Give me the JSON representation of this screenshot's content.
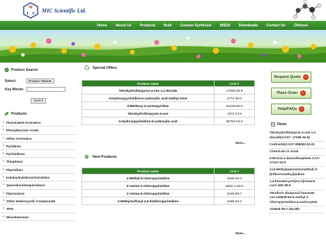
{
  "header": {
    "company": "MIC Scientific Ltd.",
    "logo_letters": [
      "M",
      "I",
      "C"
    ]
  },
  "nav": [
    "Home",
    "About Us",
    "Products",
    "Bulk",
    "Custom Synthesis",
    "MSDS",
    "Downloads",
    "Contact Us",
    "Chinese"
  ],
  "search": {
    "title": "Product Search",
    "select_label": "Select:",
    "select_value": "Product Name",
    "keyword_label": "Key Words:",
    "keyword_value": "",
    "button": "Search"
  },
  "products": {
    "title": "Products",
    "items": [
      "Fluorinated Aromatics",
      "Phenylboronic Acids",
      "Other Aromatics",
      "Pyridines",
      "Pyrimidines",
      "Thiophens",
      "Piperdines",
      "Indoles/Indolines/Oxindoles",
      "Quinolines/Isoquinolines",
      "Piperazines",
      "Other Heterocyclic Compounds",
      "APIs",
      "Miscellaneous"
    ]
  },
  "special_offers": {
    "title": "Special Offers",
    "headers": [
      "Product name",
      "CAS #"
    ],
    "rows": [
      [
        "Tetrahydrothiopyran-4-one 1,1-dioxide",
        "17396-35-9"
      ],
      [
        "4-Hydroxypyrimidine-5-carboxylic acid methyl ester",
        "4774-35-0"
      ],
      [
        "5-Methoxy-3-aminopyridine",
        "64436-92-6"
      ],
      [
        "Tetrahydrothiopyran-4-one",
        "1072-72-6"
      ],
      [
        "4-Hydroxypyrimidine-5-carboxylic acid",
        "65754-04-3"
      ]
    ],
    "more": "More..."
  },
  "new_products": {
    "title": "New Products",
    "headers": [
      "Product name",
      "CAS #"
    ],
    "rows": [
      [
        "4-Methyl-6-chloropyrimidine",
        "3435-25-4"
      ],
      [
        "5-Amino-2-chloropyrimidine",
        "5662-1-00-0"
      ],
      [
        "2-Amino-5-chloropyrimidine",
        "5428-89-7"
      ],
      [
        "2-Methylsulfonyl-4,6-dichloropyrimidine",
        "4489-34-3"
      ]
    ],
    "more": "More..."
  },
  "right": {
    "buttons": [
      "Request Quote",
      "Place Order",
      "Help/FAQs"
    ],
    "news_title": "News",
    "news": [
      "Tetrahydrothiopyran-4-one 1,1-dioxide(CAS#: 17396-35-9)",
      "Cedirainb(CAS#:288383-20-0)",
      "Chemicals in stock",
      "6-Bromo-1-benzothiophene CAS: 17347-32-9",
      "4-(4-Methylpiperazinomethyl)-3-(trifluoromethyl)aniline",
      "1,4-Diazabicyclo[3.2.2]nonane cas#:283-38-5",
      "Tenofovir disoproxil fumarate cas:149849-94-5 methyl 2-chloropyrimidine-4-carboxylate",
      "103626-36-2 (25,4R)-"
    ]
  },
  "colors": {
    "nav_green": "#2f7e25",
    "table_header": "#2f7e25",
    "logo_blue": "#1e3b86",
    "logo_red": "#cc1b1b"
  }
}
